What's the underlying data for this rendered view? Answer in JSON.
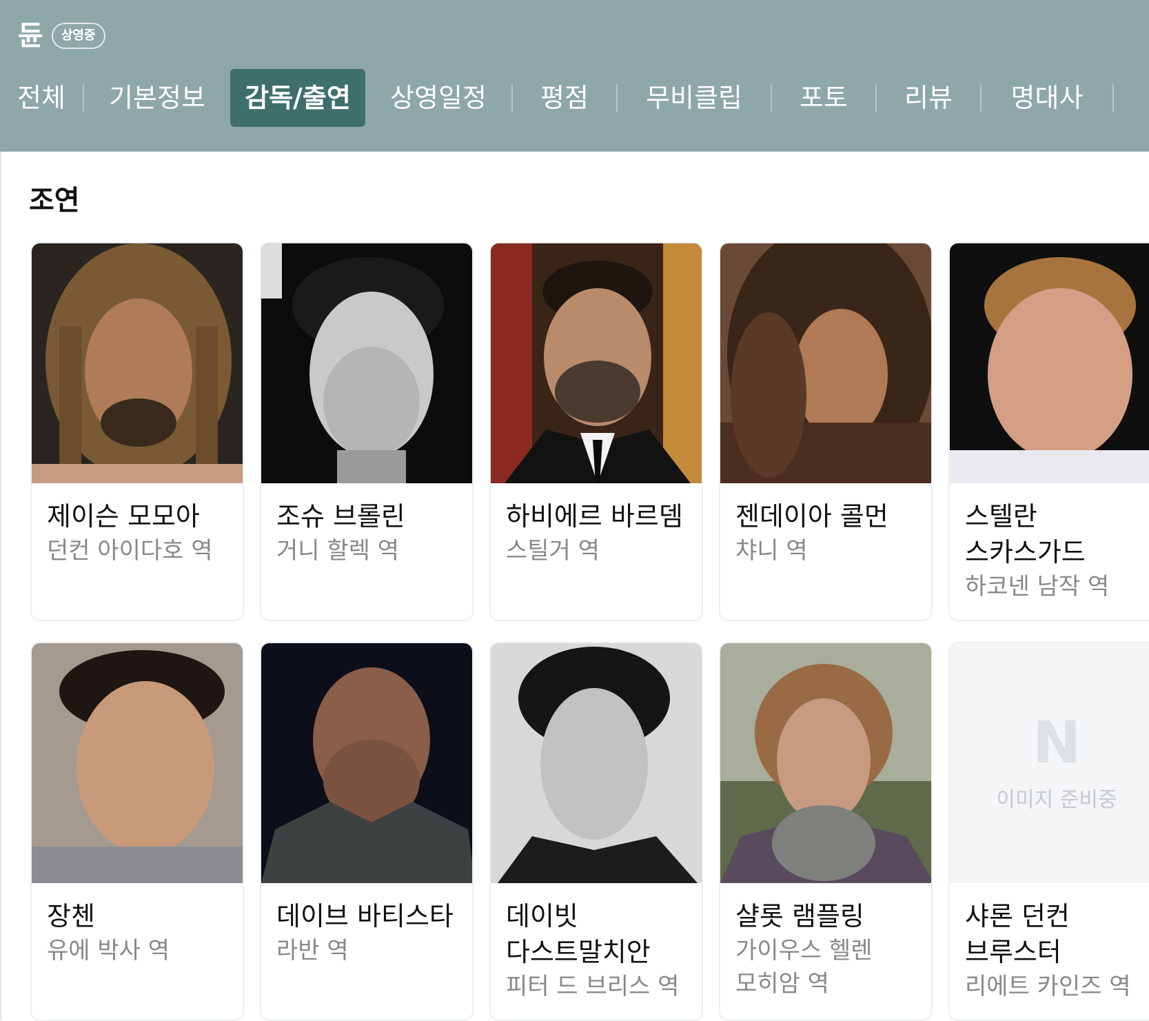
{
  "header": {
    "title": "듄",
    "badge": "상영중",
    "bg_color": "#8ea8a7",
    "active_tab_color": "#3f6f6b",
    "tabs": [
      {
        "label": "전체",
        "active": false
      },
      {
        "label": "기본정보",
        "active": false
      },
      {
        "label": "감독/출연",
        "active": true
      },
      {
        "label": "상영일정",
        "active": false
      },
      {
        "label": "평점",
        "active": false
      },
      {
        "label": "무비클립",
        "active": false
      },
      {
        "label": "포토",
        "active": false
      },
      {
        "label": "리뷰",
        "active": false
      },
      {
        "label": "명대사",
        "active": false
      }
    ]
  },
  "section": {
    "title": "조연",
    "cast": [
      {
        "name": "제이슨 모모아",
        "role": "던컨 아이다호 역",
        "photo": "portrait-dreadlocks"
      },
      {
        "name": "조슈 브롤린",
        "role": "거니 할렉 역",
        "photo": "portrait-bw"
      },
      {
        "name": "하비에르 바르뎀",
        "role": "스틸거 역",
        "photo": "portrait-suit"
      },
      {
        "name": "젠데이아 콜먼",
        "role": "챠니 역",
        "photo": "portrait-curly-hair"
      },
      {
        "name": "스텔란 스카스가드",
        "role": "하코넨 남작 역",
        "photo": "portrait-blond"
      },
      {
        "name": "장첸",
        "role": "유에 박사 역",
        "photo": "portrait-young-man"
      },
      {
        "name": "데이브 바티스타",
        "role": "라반 역",
        "photo": "portrait-bald"
      },
      {
        "name": "데이빗 다스트말치안",
        "role": "피터 드 브리스 역",
        "photo": "portrait-bw-dark-hair"
      },
      {
        "name": "샬롯 램플링",
        "role": "가이우스 헬렌 모히암 역",
        "photo": "portrait-scarf"
      },
      {
        "name": "샤론 던컨 브루스터",
        "role": "리에트 카인즈 역",
        "photo": "placeholder",
        "placeholder_text": "이미지 준비중",
        "placeholder_logo": "N"
      }
    ]
  }
}
